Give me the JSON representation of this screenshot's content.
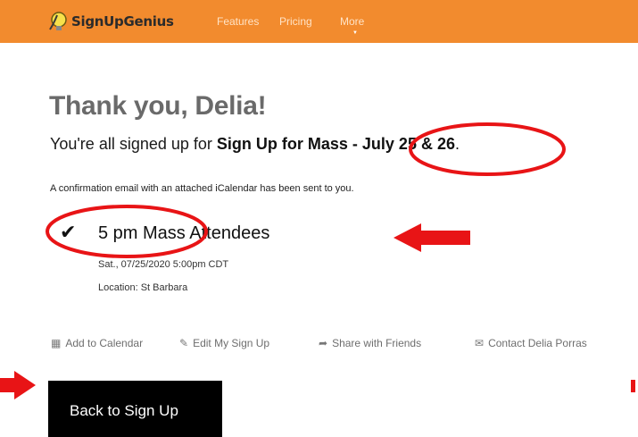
{
  "header": {
    "logo_text": "SignUpGenius",
    "nav": {
      "features": "Features",
      "pricing": "Pricing",
      "more": "More"
    },
    "bg_color": "#f28b2e"
  },
  "page": {
    "title": "Thank you, Delia!",
    "subtitle_prefix": "You're all signed up for ",
    "subtitle_bold": "Sign Up for Mass - July 25 & 26",
    "subtitle_suffix": ".",
    "confirmation": "A confirmation email with an attached iCalendar has been sent to you."
  },
  "slot": {
    "icon": "checkmark-icon",
    "title": "5 pm Mass Attendees",
    "date": "Sat., 07/25/2020 5:00pm CDT",
    "location": "Location: St Barbara"
  },
  "actions": {
    "add_calendar": "Add to Calendar",
    "edit_signup": "Edit My Sign Up",
    "share": "Share with Friends",
    "contact": "Contact Delia Porras"
  },
  "back_button": "Back to Sign Up",
  "annotation_color": "#e81416"
}
